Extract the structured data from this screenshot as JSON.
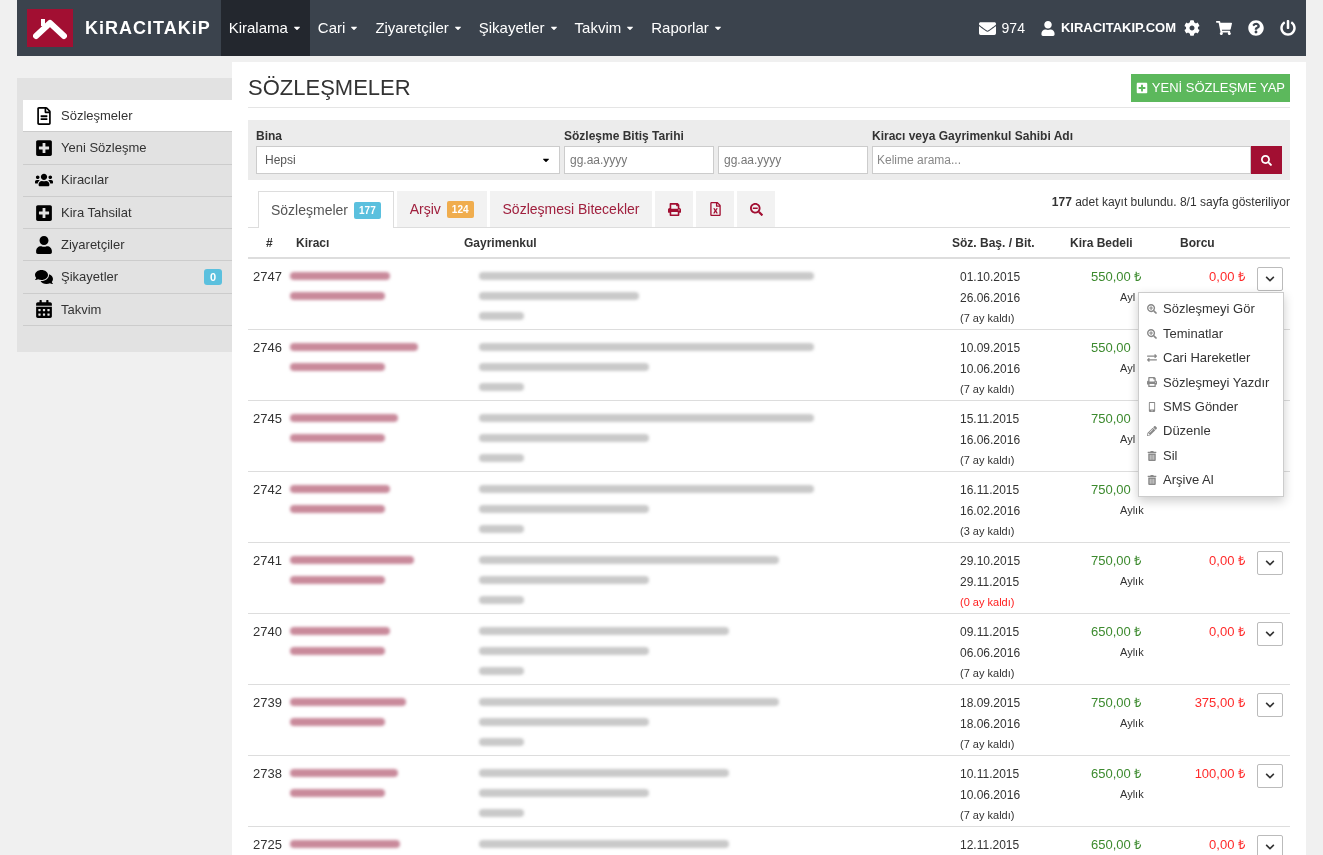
{
  "brand": "KiRACITAKiP",
  "nav": [
    {
      "label": "Kiralama",
      "selected": true
    },
    {
      "label": "Cari",
      "selected": false
    },
    {
      "label": "Ziyaretçiler",
      "selected": false
    },
    {
      "label": "Şikayetler",
      "selected": false
    },
    {
      "label": "Takvim",
      "selected": false
    },
    {
      "label": "Raporlar",
      "selected": false
    }
  ],
  "messages_count": "974",
  "account": "KIRACITAKIP.COM",
  "sidebar": {
    "items": [
      {
        "label": "Sözleşmeler",
        "selected": true
      },
      {
        "label": "Yeni Sözleşme",
        "selected": false
      },
      {
        "label": "Kiracılar",
        "selected": false
      },
      {
        "label": "Kira Tahsilat",
        "selected": false
      },
      {
        "label": "Ziyaretçiler",
        "selected": false
      },
      {
        "label": "Şikayetler",
        "selected": false,
        "badge": "0"
      },
      {
        "label": "Takvim",
        "selected": false
      }
    ]
  },
  "page_title": "SÖZLEŞMELER",
  "new_button": "YENİ SÖZLEŞME YAP",
  "filters": {
    "building_label": "Bina",
    "building_value": "Hepsi",
    "end_date_label": "Sözleşme Bitiş Tarihi",
    "date_from_placeholder": "gg.aa.yyyy",
    "date_to_placeholder": "gg.aa.yyyy",
    "search_label": "Kiracı veya Gayrimenkul Sahibi Adı",
    "search_placeholder": "Kelime arama..."
  },
  "tabs": [
    {
      "label": "Sözleşmeler",
      "badge": "177",
      "color": "#5bc0de",
      "selected": true
    },
    {
      "label": "Arşiv",
      "badge": "124",
      "color": "#f0ad4e",
      "selected": false
    },
    {
      "label": "Sözleşmesi Bitecekler",
      "selected": false
    }
  ],
  "record_summary": "**177** adet kayıt bulundu. 8/1 sayfa gösteriliyor",
  "table": {
    "columns": [
      "#",
      "Kiracı",
      "Gayrimenkul",
      "Söz. Baş. / Bit.",
      "Kira Bedeli",
      "Borcu"
    ],
    "rows": [
      {
        "id": "2747",
        "start": "01.10.2015",
        "end": "26.06.2016",
        "remaining": "(7 ay kaldı)",
        "urgent": false,
        "rent": "550,00 ₺",
        "period": "Ayl",
        "debt": "0,00 ₺",
        "menu_button": true
      },
      {
        "id": "2746",
        "start": "10.09.2015",
        "end": "10.06.2016",
        "remaining": "(7 ay kaldı)",
        "urgent": false,
        "rent": "550,00",
        "period": "Ayl",
        "menu_button": false
      },
      {
        "id": "2745",
        "start": "15.11.2015",
        "end": "16.06.2016",
        "remaining": "(7 ay kaldı)",
        "urgent": false,
        "rent": "750,00",
        "period": "Ayl",
        "menu_button": false
      },
      {
        "id": "2742",
        "start": "16.11.2015",
        "end": "16.02.2016",
        "remaining": "(3 ay kaldı)",
        "urgent": false,
        "rent": "750,00",
        "period": "Aylık",
        "menu_button": false
      },
      {
        "id": "2741",
        "start": "29.10.2015",
        "end": "29.11.2015",
        "remaining": "(0 ay kaldı)",
        "urgent": true,
        "rent": "750,00 ₺",
        "period": "Aylık",
        "debt": "0,00 ₺",
        "menu_button": true
      },
      {
        "id": "2740",
        "start": "09.11.2015",
        "end": "06.06.2016",
        "remaining": "(7 ay kaldı)",
        "urgent": false,
        "rent": "650,00 ₺",
        "period": "Aylık",
        "debt": "0,00 ₺",
        "menu_button": true
      },
      {
        "id": "2739",
        "start": "18.09.2015",
        "end": "18.06.2016",
        "remaining": "(7 ay kaldı)",
        "urgent": false,
        "rent": "750,00 ₺",
        "period": "Aylık",
        "debt": "375,00 ₺",
        "menu_button": true
      },
      {
        "id": "2738",
        "start": "10.11.2015",
        "end": "10.06.2016",
        "remaining": "(7 ay kaldı)",
        "urgent": false,
        "rent": "650,00 ₺",
        "period": "Aylık",
        "debt": "100,00 ₺",
        "menu_button": true
      },
      {
        "id": "2725",
        "start": "12.11.2015",
        "rent": "650,00 ₺",
        "debt": "0,00 ₺",
        "menu_button": true
      }
    ]
  },
  "row_menu": [
    {
      "label": "Sözleşmeyi Gör",
      "kind": "zoom"
    },
    {
      "label": "Teminatlar",
      "kind": "zoom"
    },
    {
      "label": "Cari Hareketler",
      "kind": "exchange"
    },
    {
      "label": "Sözleşmeyi Yazdır",
      "kind": "print"
    },
    {
      "label": "SMS Gönder",
      "kind": "mobile"
    },
    {
      "label": "Düzenle",
      "kind": "pencil"
    },
    {
      "label": "Sil",
      "kind": "trash"
    },
    {
      "label": "Arşive Al",
      "kind": "trash"
    }
  ]
}
